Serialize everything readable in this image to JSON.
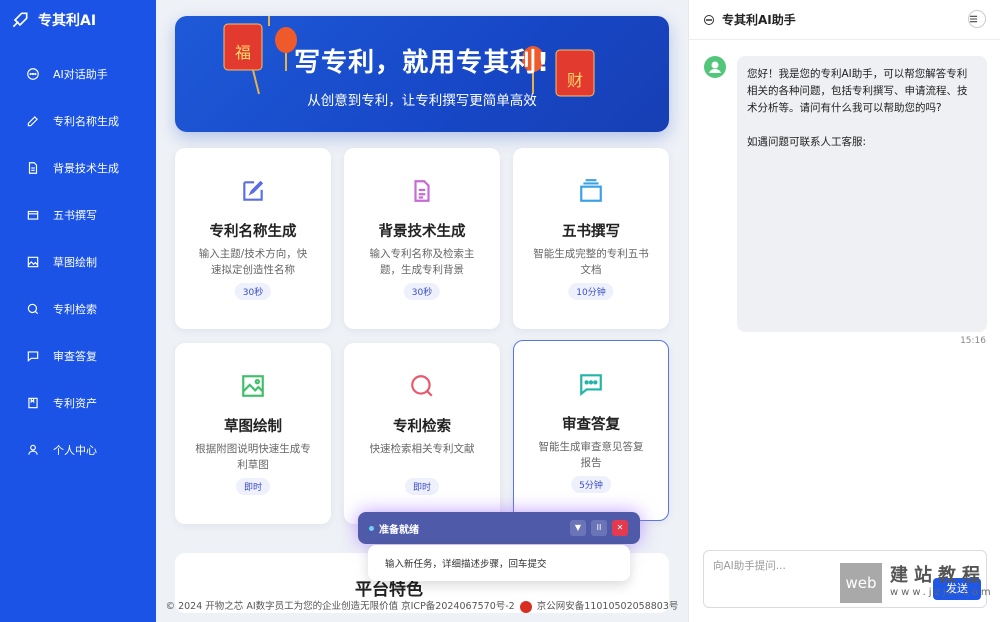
{
  "brand": {
    "name": "专其利AI"
  },
  "sidebar": {
    "items": [
      {
        "label": "AI对话助手",
        "icon": "chat-bubble-icon"
      },
      {
        "label": "专利名称生成",
        "icon": "edit-icon"
      },
      {
        "label": "背景技术生成",
        "icon": "document-icon"
      },
      {
        "label": "五书撰写",
        "icon": "layers-icon"
      },
      {
        "label": "草图绘制",
        "icon": "image-icon"
      },
      {
        "label": "专利检索",
        "icon": "search-icon"
      },
      {
        "label": "审查答复",
        "icon": "message-dots-icon"
      },
      {
        "label": "专利资产",
        "icon": "bookmark-icon"
      },
      {
        "label": "个人中心",
        "icon": "user-icon"
      }
    ]
  },
  "banner": {
    "title": "写专利，就用专其利!",
    "subtitle": "从创意到专利，让专利撰写更简单高效",
    "deco": {
      "fu": "福",
      "cai": "财"
    }
  },
  "cards": [
    {
      "title": "专利名称生成",
      "desc": "输入主题/技术方向，快速拟定创造性名称",
      "tag": "30秒",
      "icon": "edit-icon",
      "color": "#5b6ee1"
    },
    {
      "title": "背景技术生成",
      "desc": "输入专利名称及检索主题，生成专利背景",
      "tag": "30秒",
      "icon": "document-icon",
      "color": "#c86ad6"
    },
    {
      "title": "五书撰写",
      "desc": "智能生成完整的专利五书文档",
      "tag": "10分钟",
      "icon": "layers-icon",
      "color": "#3aa0e8"
    },
    {
      "title": "草图绘制",
      "desc": "根据附图说明快速生成专利草图",
      "tag": "即时",
      "icon": "image-icon",
      "color": "#3fbf6a"
    },
    {
      "title": "专利检索",
      "desc": "快速检索相关专利文献",
      "tag": "即时",
      "icon": "search-icon",
      "color": "#e8576b"
    },
    {
      "title": "审查答复",
      "desc": "智能生成审查意见答复报告",
      "tag": "5分钟",
      "icon": "message-dots-icon",
      "color": "#21b5a8"
    }
  ],
  "task_section": {
    "title": "平台特色"
  },
  "agent_bar": {
    "status": "准备就绪",
    "input_placeholder": "输入新任务，详细描述步骤，回车提交",
    "buttons": {
      "down": "▼",
      "pause": "II",
      "close": "✕"
    }
  },
  "footer": {
    "text": "© 2024 开物之芯 AI数字员工为您的企业创造无限价值 京ICP备2024067570号-2",
    "police": "京公网安备11010502058803号"
  },
  "chat": {
    "title": "专其利AI助手",
    "message_line1": "您好！我是您的专利AI助手，可以帮您解答专利相关的各种问题，包括专利撰写、申请流程、技术分析等。请问有什么我可以帮助您的吗?",
    "message_line2": "如遇问题可联系人工客服:",
    "time": "15:16",
    "input_placeholder": "向AI助手提问...",
    "send": "发送"
  },
  "watermark": {
    "box": "web",
    "line1": "建站教程",
    "line2": "www.jzjc.com"
  },
  "colors": {
    "primary": "#1a53e6",
    "accent": "#5b74e8"
  }
}
